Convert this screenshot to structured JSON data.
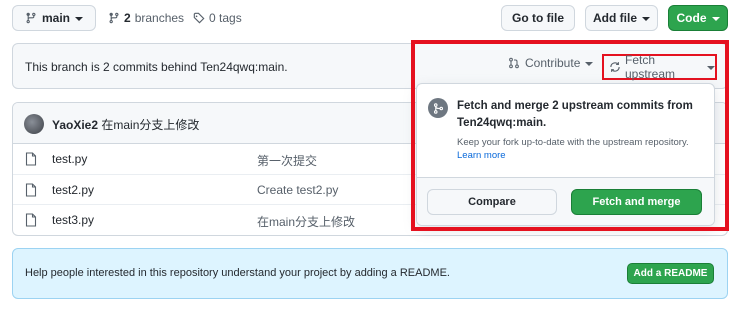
{
  "toolbar": {
    "branch_label": "main",
    "branches_count": "2",
    "branches_label": "branches",
    "tags_label": "0 tags",
    "go_to_file": "Go to file",
    "add_file": "Add file",
    "code": "Code"
  },
  "branch_status": {
    "text": "This branch is 2 commits behind Ten24qwq:main.",
    "contribute": "Contribute",
    "fetch_upstream": "Fetch upstream"
  },
  "fetch_dropdown": {
    "title": "Fetch and merge 2 upstream commits from Ten24qwq:main.",
    "description": "Keep your fork up-to-date with the upstream repository.",
    "learn_more": "Learn more",
    "compare": "Compare",
    "fetch_and_merge": "Fetch and merge"
  },
  "latest_commit": {
    "author": "YaoXie2",
    "message": "在main分支上修改"
  },
  "files": [
    {
      "name": "test.py",
      "message": "第一次提交"
    },
    {
      "name": "test2.py",
      "message": "Create test2.py"
    },
    {
      "name": "test3.py",
      "message": "在main分支上修改"
    }
  ],
  "readme": {
    "text": "Help people interested in this repository understand your project by adding a README.",
    "button": "Add a README"
  },
  "colors": {
    "green": "#2da44e",
    "highlight_red": "#e5111f",
    "info_blue_bg": "#ddf4ff"
  }
}
